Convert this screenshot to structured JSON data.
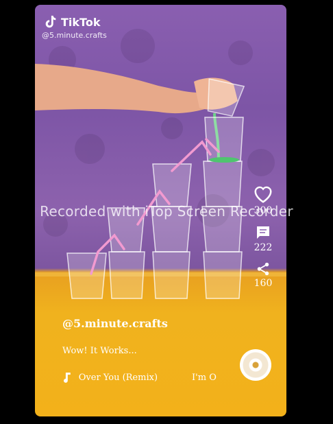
{
  "app": {
    "name": "TikTok",
    "handle": "@5.minute.crafts"
  },
  "actions": {
    "likes": "300",
    "comments": "222",
    "shares": "160"
  },
  "caption": {
    "username": "@5.minute.crafts",
    "description": "Wow! It Works...",
    "music_a": "Over You (Remix)",
    "music_b": "I'm O"
  },
  "watermark": "Recorded with iTop Screen Recorder",
  "icons": {
    "logo": "tiktok-note-icon",
    "like": "heart-icon",
    "comment": "comment-icon",
    "share": "share-icon",
    "music": "music-note-icon",
    "disc": "music-disc-icon"
  },
  "colors": {
    "wall": "#8a5fb0",
    "table": "#f0b21e",
    "straw": "#f29ad0",
    "text": "#ffffff"
  }
}
